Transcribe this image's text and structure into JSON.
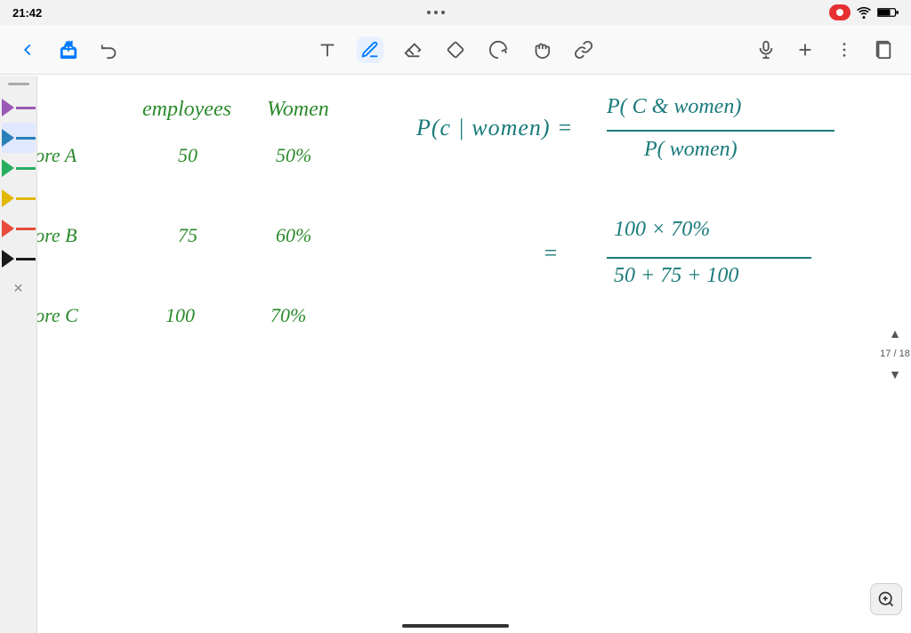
{
  "statusBar": {
    "time": "21:42",
    "dots": 3,
    "batteryLevel": "75"
  },
  "toolbar": {
    "tools": [
      {
        "name": "back",
        "label": "Back"
      },
      {
        "name": "share",
        "label": "Share"
      },
      {
        "name": "undo",
        "label": "Undo"
      },
      {
        "name": "text",
        "label": "Text Tool"
      },
      {
        "name": "pen",
        "label": "Pen Tool"
      },
      {
        "name": "eraser-outline",
        "label": "Eraser Outline"
      },
      {
        "name": "eraser-fill",
        "label": "Eraser Fill"
      },
      {
        "name": "lasso",
        "label": "Lasso"
      },
      {
        "name": "hand",
        "label": "Hand"
      },
      {
        "name": "link",
        "label": "Link"
      },
      {
        "name": "microphone",
        "label": "Microphone"
      },
      {
        "name": "add",
        "label": "Add"
      },
      {
        "name": "more",
        "label": "More"
      },
      {
        "name": "pages",
        "label": "Pages"
      }
    ]
  },
  "content": {
    "tableHeader": {
      "col1": "employees",
      "col2": "Women"
    },
    "rows": [
      {
        "store": "Store A",
        "employees": "50",
        "women": "50%"
      },
      {
        "store": "Store B",
        "employees": "75",
        "women": "60%"
      },
      {
        "store": "Store C",
        "employees": "100",
        "women": "70%"
      }
    ],
    "formula": {
      "left": "P(c | women) =",
      "numerator": "P( C & women)",
      "denominator": "P( women)",
      "equals": "=",
      "numValue": "100 × 70%",
      "denomValue": "50 + 75 + 100"
    }
  },
  "colorPalette": {
    "swatches": [
      {
        "color": "#9b59b6",
        "label": "purple"
      },
      {
        "color": "#2980b9",
        "label": "blue"
      },
      {
        "color": "#27ae60",
        "label": "green"
      },
      {
        "color": "#f1c40f",
        "label": "yellow"
      },
      {
        "color": "#e74c3c",
        "label": "red"
      },
      {
        "color": "#1a1a1a",
        "label": "black"
      }
    ]
  },
  "pageNav": {
    "current": "17",
    "separator": "/",
    "total": "18"
  },
  "zoomButton": {
    "label": "⊕"
  }
}
